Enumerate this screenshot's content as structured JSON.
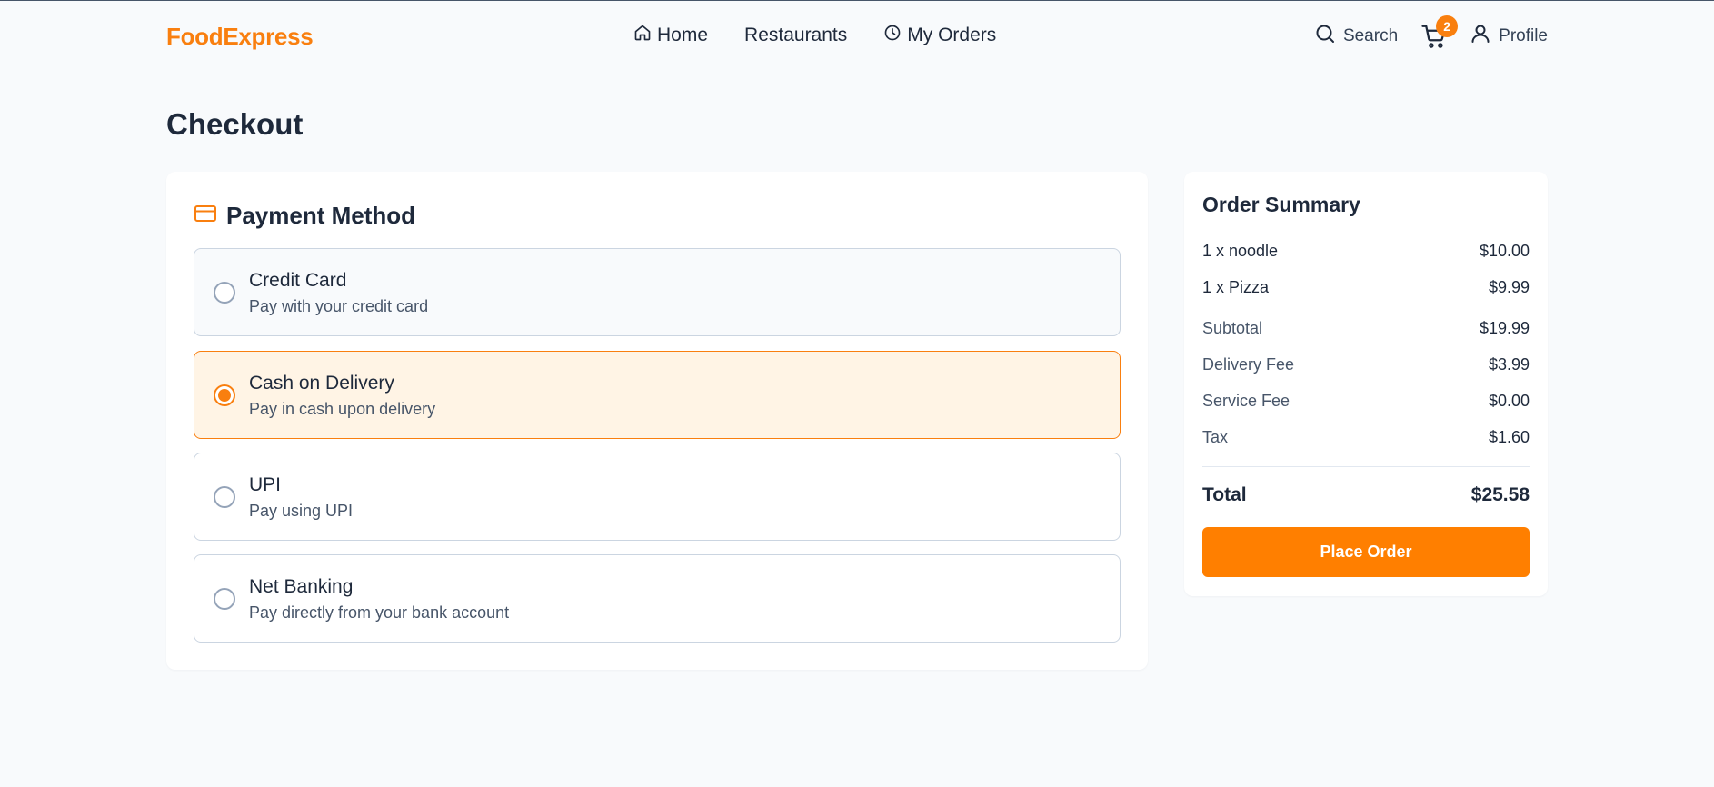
{
  "brand": {
    "name": "FoodExpress",
    "accent": "#f97f0f"
  },
  "nav": {
    "home": {
      "label": "Home",
      "icon": "home-icon"
    },
    "restaurants": {
      "label": "Restaurants"
    },
    "orders": {
      "label": "My Orders",
      "icon": "clock-icon"
    }
  },
  "header_actions": {
    "search": {
      "label": "Search",
      "icon": "search-icon"
    },
    "cart": {
      "icon": "cart-icon",
      "badge": "2"
    },
    "profile": {
      "label": "Profile",
      "icon": "user-icon"
    }
  },
  "page": {
    "title": "Checkout"
  },
  "payment": {
    "title": "Payment Method",
    "icon": "credit-card-icon",
    "selected": "Cash on Delivery",
    "options": [
      {
        "label": "Credit Card",
        "description": "Pay with your credit card"
      },
      {
        "label": "Cash on Delivery",
        "description": "Pay in cash upon delivery"
      },
      {
        "label": "UPI",
        "description": "Pay using UPI"
      },
      {
        "label": "Net Banking",
        "description": "Pay directly from your bank account"
      }
    ]
  },
  "summary": {
    "title": "Order Summary",
    "items": [
      {
        "name": "1 x noodle",
        "price": "$10.00"
      },
      {
        "name": "1 x Pizza",
        "price": "$9.99"
      }
    ],
    "subtotal": {
      "label": "Subtotal",
      "value": "$19.99"
    },
    "delivery_fee": {
      "label": "Delivery Fee",
      "value": "$3.99"
    },
    "service_fee": {
      "label": "Service Fee",
      "value": "$0.00"
    },
    "tax": {
      "label": "Tax",
      "value": "$1.60"
    },
    "total": {
      "label": "Total",
      "value": "$25.58"
    },
    "cta": "Place Order"
  }
}
